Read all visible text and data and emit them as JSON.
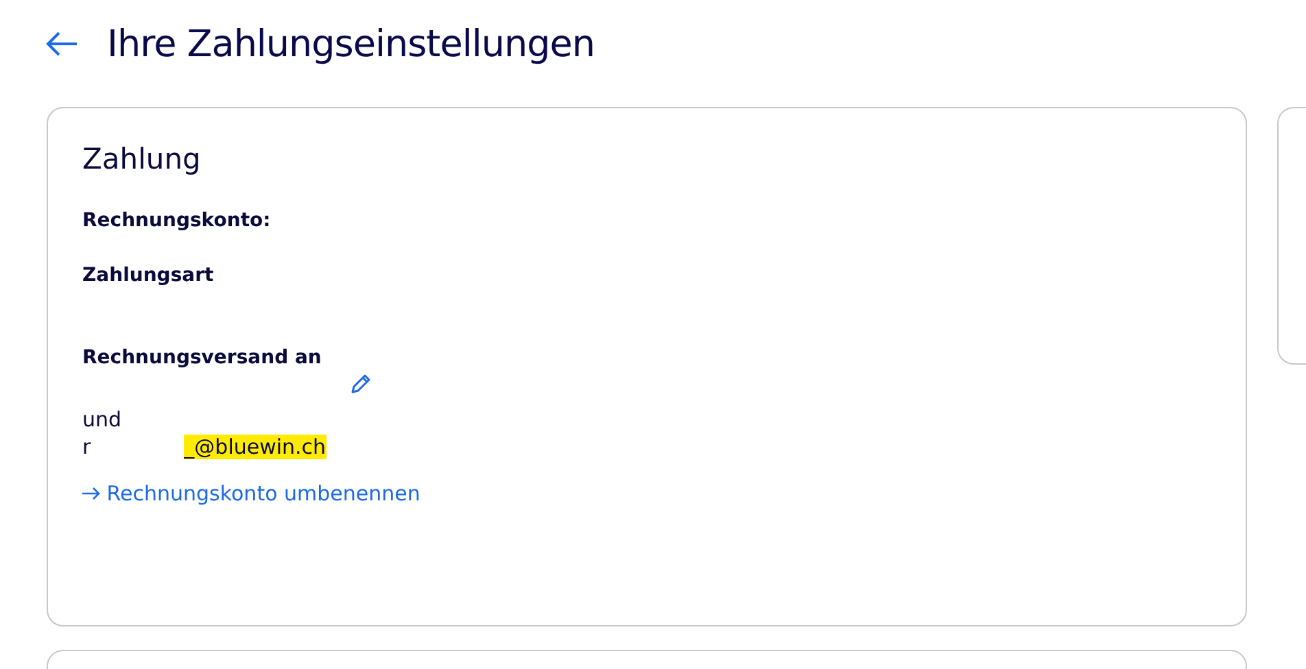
{
  "header": {
    "title": "Ihre Zahlungseinstellungen"
  },
  "payment": {
    "title": "Zahlung",
    "account_label": "Rechnungskonto:",
    "method_label": "Zahlungsart",
    "delivery_label": "Rechnungsversand an",
    "conjunction": "und",
    "email_start": "r",
    "email_highlighted": "_@bluewin.ch",
    "link": "Rechnungskonto umbenennen"
  }
}
